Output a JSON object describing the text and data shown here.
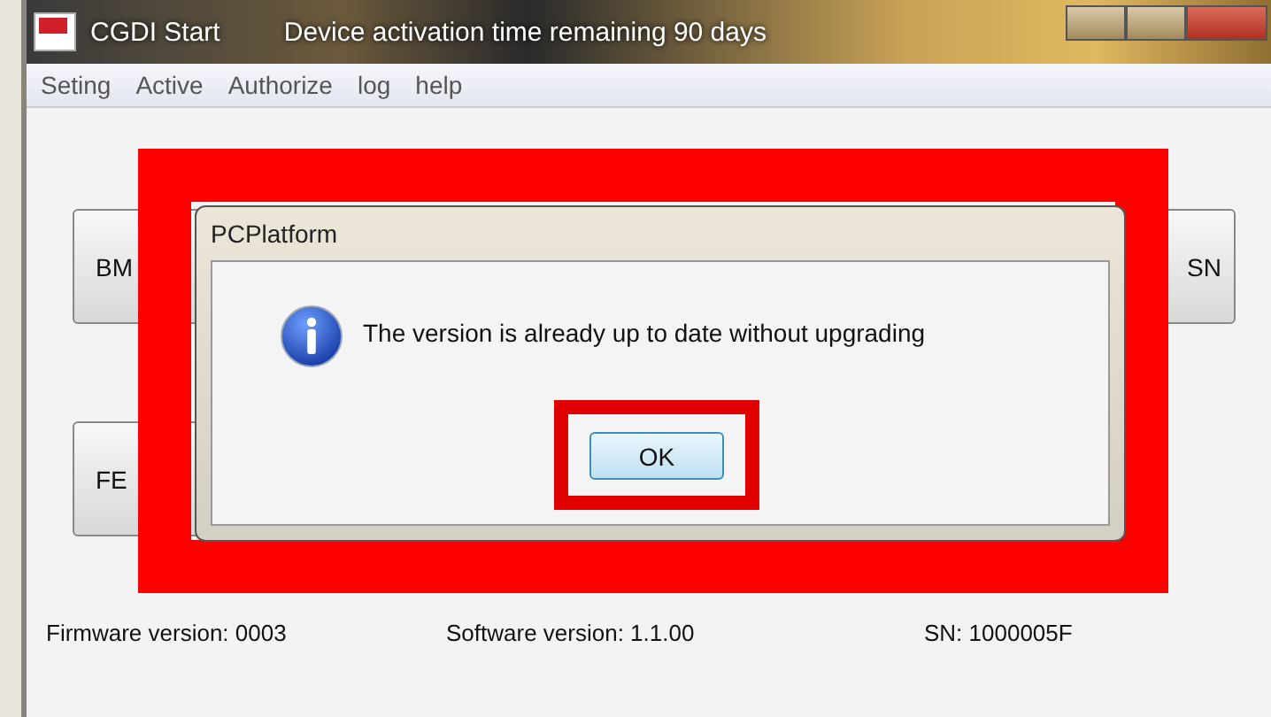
{
  "window": {
    "title": "CGDI Start",
    "notice": "Device activation time remaining 90 days"
  },
  "menu": [
    "Seting",
    "Active",
    "Authorize",
    "log",
    "help"
  ],
  "function_buttons": [
    {
      "label": "BM"
    },
    {
      "label": "SN"
    },
    {
      "label": "FE"
    }
  ],
  "status": [
    {
      "label": "Firmware version: 0003"
    },
    {
      "label": "Software version:  1.1.00"
    },
    {
      "label": "SN:  1000005F"
    }
  ],
  "dialog": {
    "title": "PCPlatform",
    "message": "The version is already up to date without upgrading",
    "button": "OK"
  }
}
